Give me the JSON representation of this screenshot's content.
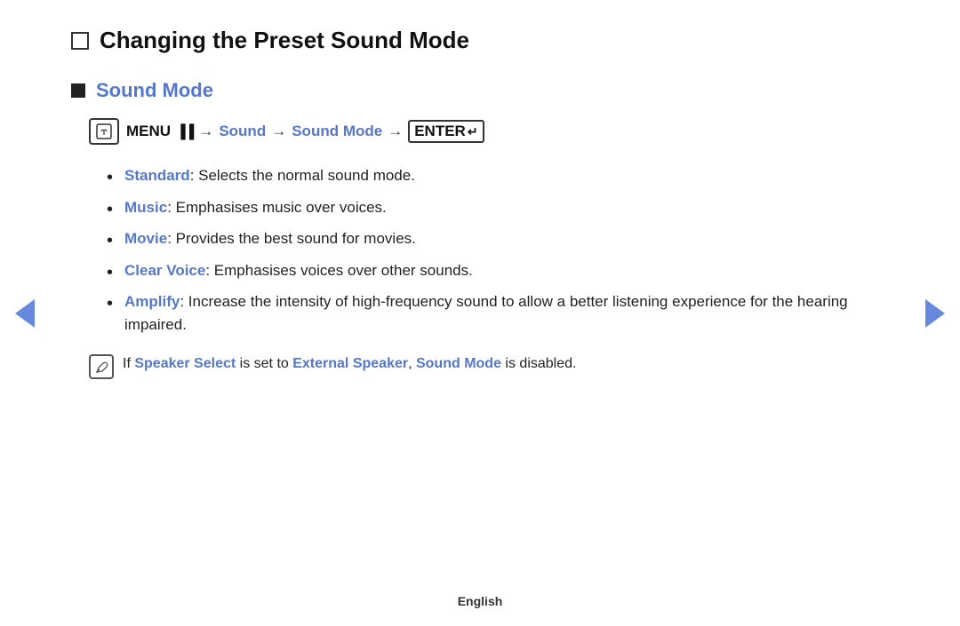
{
  "page": {
    "title": "Changing the Preset Sound Mode",
    "section": {
      "heading": "Sound Mode",
      "menu_path": {
        "icon_label": "m",
        "menu_label": "MENU",
        "menu_symbol": "▐▐",
        "arrow": "→",
        "sound": "Sound",
        "sound_mode": "Sound Mode",
        "enter_label": "ENTER",
        "enter_symbol": "↵"
      },
      "bullet_items": [
        {
          "term": "Standard",
          "description": ": Selects the normal sound mode."
        },
        {
          "term": "Music",
          "description": ": Emphasises music over voices."
        },
        {
          "term": "Movie",
          "description": ": Provides the best sound for movies."
        },
        {
          "term": "Clear Voice",
          "description": ": Emphasises voices over other sounds."
        },
        {
          "term": "Amplify",
          "description": ": Increase the intensity of high-frequency sound to allow a better listening experience for the hearing impaired."
        }
      ],
      "note": {
        "icon": "✎",
        "prefix": " If ",
        "term1": "Speaker Select",
        "middle": " is set to ",
        "term2": "External Speaker",
        "comma": ", ",
        "term3": "Sound Mode",
        "suffix": " is disabled."
      }
    },
    "footer": "English",
    "nav": {
      "left_label": "previous",
      "right_label": "next"
    }
  }
}
